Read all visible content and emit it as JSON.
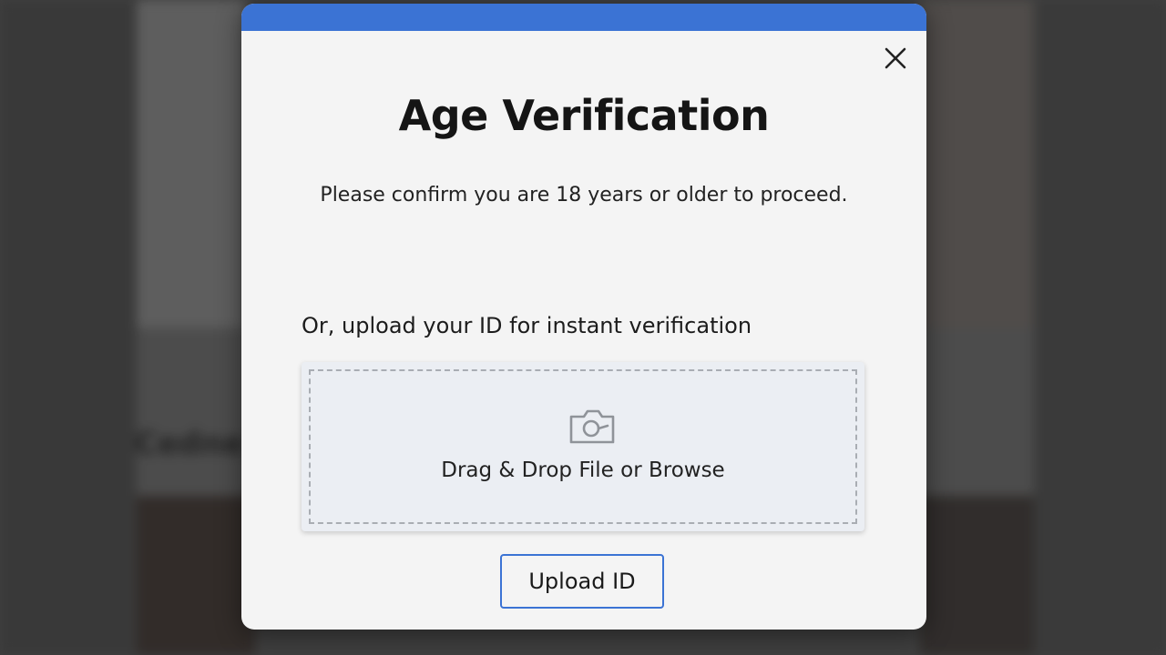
{
  "background": {
    "section_title": "Cedne"
  },
  "modal": {
    "accent_color": "#3b73d4",
    "close_icon": "close-icon",
    "title": "Age Verification",
    "subtitle": "Please confirm you are 18 years or older to proceed.",
    "upload_label": "Or, upload your ID for instant verification",
    "dropzone": {
      "icon": "camera-icon",
      "text": "Drag & Drop File or Browse"
    },
    "upload_button_label": "Upload ID"
  }
}
